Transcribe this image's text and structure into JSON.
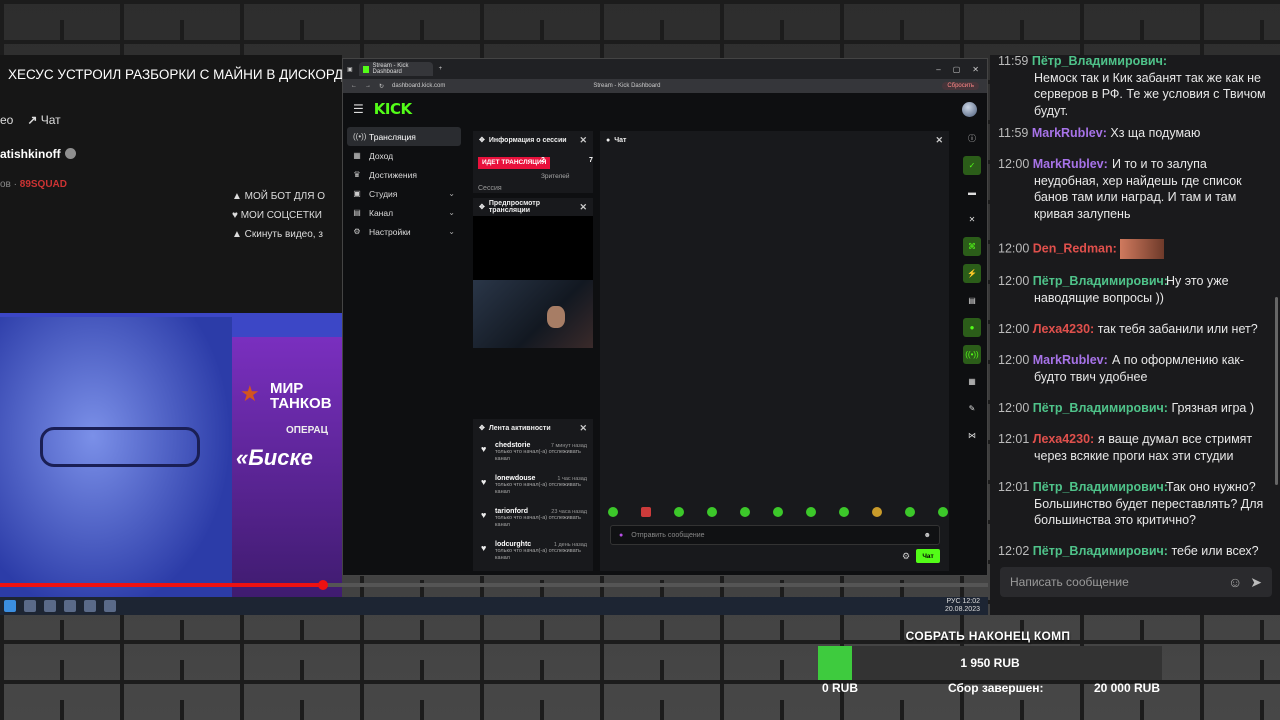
{
  "youtube": {
    "video_title": "ХЕСУС УСТРОИЛ РАЗБОРКИ С МАЙНИ В ДИСКОРДЕ |",
    "share_prefix": "ео",
    "share_label": "Чат",
    "channel": "atishkinoff",
    "subtitle_prefix": "ов ·",
    "subtitle_tag": "89SQUAD",
    "links": [
      "▲ МОЙ БОТ ДЛЯ О",
      "♥ МОИ СОЦСЕТКИ",
      "▲ Скинуть видео, з"
    ],
    "ad_brand": "МИР ТАНКОВ",
    "ad_line2": "ОПЕРАЦ",
    "ad_line3": "«Биске"
  },
  "browser": {
    "tab_title": "Stream - Kick Dashboard",
    "url": "dashboard.kick.com",
    "page_title": "Stream - Kick Dashboard",
    "reset_label": "Сбросить"
  },
  "kick": {
    "logo": "KICK",
    "nav": [
      {
        "label": "Трансляция",
        "icon": "((•))",
        "active": true
      },
      {
        "label": "Доход",
        "icon": "▦"
      },
      {
        "label": "Достижения",
        "icon": "🏆"
      },
      {
        "label": "Студия",
        "icon": "▣",
        "chevron": true
      },
      {
        "label": "Канал",
        "icon": "▤",
        "chevron": true
      },
      {
        "label": "Настройки",
        "icon": "⚙",
        "chevron": true
      }
    ],
    "session": {
      "title": "Информация о сессии",
      "live_badge": "ИДЕТ ТРАНСЛЯЦИЯ",
      "viewers": "2",
      "viewers_label": "Зрителей",
      "followers_partial": "7",
      "session_label": "Сессия"
    },
    "preview": {
      "title": "Предпросмотр трансляции"
    },
    "activity": {
      "title": "Лента активности",
      "items": [
        {
          "user": "chedstorie",
          "time": "7 минут назад",
          "desc": "только что начал(-а) отслеживать канал"
        },
        {
          "user": "lonewdouse",
          "time": "1 час назад",
          "desc": "только что начал(-а) отслеживать канал"
        },
        {
          "user": "tarionford",
          "time": "23 часа назад",
          "desc": "только что начал(-а) отслеживать канал"
        },
        {
          "user": "lodcurghtc",
          "time": "1 день назад",
          "desc": "только что начал(-а) отслеживать канал"
        }
      ]
    },
    "chat": {
      "title": "Чат",
      "input_placeholder": "Отправить сообщение",
      "send_label": "Чат"
    }
  },
  "right_chat": {
    "messages": [
      {
        "time": "11:59",
        "nick": "Пётр_Владимирович:",
        "color": "#4fc38a",
        "text": "Немоск так и Кик забанят так же как не серверов в РФ. Те же условия с Твичом будут."
      },
      {
        "time": "11:59",
        "nick": "MarkRublev:",
        "color": "#a773e8",
        "text": "Хз ща подумаю"
      },
      {
        "time": "12:00",
        "nick": "MarkRublev:",
        "color": "#a773e8",
        "text": "И то и то залупа неудобная, хер найдешь где список банов там или наград. И там и там кривая залупень"
      },
      {
        "time": "12:00",
        "nick": "Den_Redman:",
        "color": "#e0504c",
        "text": ""
      },
      {
        "time": "12:00",
        "nick": "Пётр_Владимирович:",
        "color": "#4fc38a",
        "text": "Ну это уже наводящие вопросы ))"
      },
      {
        "time": "12:00",
        "nick": "Леха4230:",
        "color": "#e0504c",
        "text": "так тебя забанили или нет?"
      },
      {
        "time": "12:00",
        "nick": "MarkRublev:",
        "color": "#a773e8",
        "text": "А по оформлению как-будто твич удобнее"
      },
      {
        "time": "12:00",
        "nick": "Пётр_Владимирович:",
        "color": "#4fc38a",
        "text": "Грязная игра )"
      },
      {
        "time": "12:01",
        "nick": "Леха4230:",
        "color": "#e0504c",
        "text": "я ваще думал все стримят через всякие проги нах эти студии"
      },
      {
        "time": "12:01",
        "nick": "Пётр_Владимирович:",
        "color": "#4fc38a",
        "text": "Так оно нужно? Большинство будет переставлять? Для большинства это критично?"
      },
      {
        "time": "12:02",
        "nick": "Пётр_Владимирович:",
        "color": "#4fc38a",
        "text": "тебе или всех?"
      }
    ],
    "input_placeholder": "Написать сообщение"
  },
  "goal": {
    "title": "СОБРАТЬ НАКОНЕЦ КОМП",
    "current": "1 950 RUB",
    "min": "0 RUB",
    "status": "Сбор завершен:",
    "target": "20 000 RUB",
    "progress_fraction": 0.0975
  },
  "taskbar": {
    "time": "12:02",
    "date": "20.08.2023",
    "lang": "РУС"
  }
}
